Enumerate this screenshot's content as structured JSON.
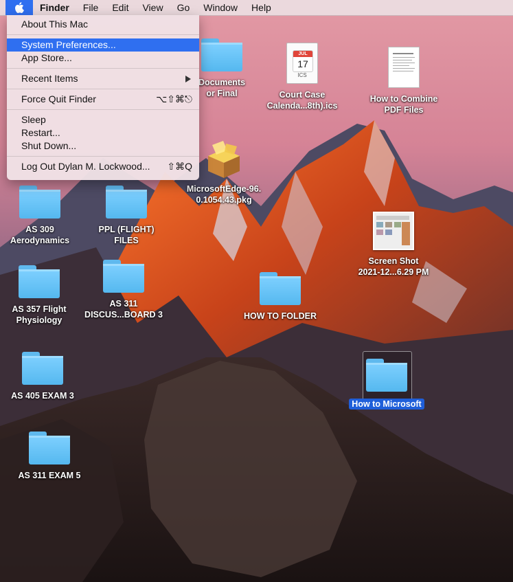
{
  "menubar": {
    "apple": "",
    "items": [
      "Finder",
      "File",
      "Edit",
      "View",
      "Go",
      "Window",
      "Help"
    ]
  },
  "apple_menu": {
    "about": "About This Mac",
    "system_prefs": "System Preferences...",
    "app_store": "App Store...",
    "recent": "Recent Items",
    "force_quit": "Force Quit Finder",
    "force_quit_shortcut": "⌥⇧⌘⎋",
    "sleep": "Sleep",
    "restart": "Restart...",
    "shutdown": "Shut Down...",
    "logout": "Log Out Dylan M. Lockwood...",
    "logout_shortcut": "⇧⌘Q"
  },
  "desktop": {
    "documents": "Documents\nor Final",
    "ics_month": "JUL",
    "ics_day": "17",
    "ics_ext": "ICS",
    "ics_label": "Court Case\nCalenda...8th).ics",
    "pdf_label": "How to Combine\nPDF Files",
    "pkg_label": "MicrosoftEdge-96.\n0.1054.43.pkg",
    "as309": "AS 309\nAerodynamics",
    "ppl": "PPL (FLIGHT)\nFILES",
    "screenshot": "Screen Shot\n2021-12...6.29 PM",
    "as357": "AS 357 Flight\nPhysiology",
    "as311d": "AS 311\nDISCUS...BOARD 3",
    "howto": "HOW TO FOLDER",
    "as405": "AS 405 EXAM 3",
    "howtoms": "How to Microsoft",
    "as311e": "AS 311 EXAM 5"
  },
  "colors": {
    "selection": "#2f6ff0",
    "folder": "#6cc6fb"
  }
}
